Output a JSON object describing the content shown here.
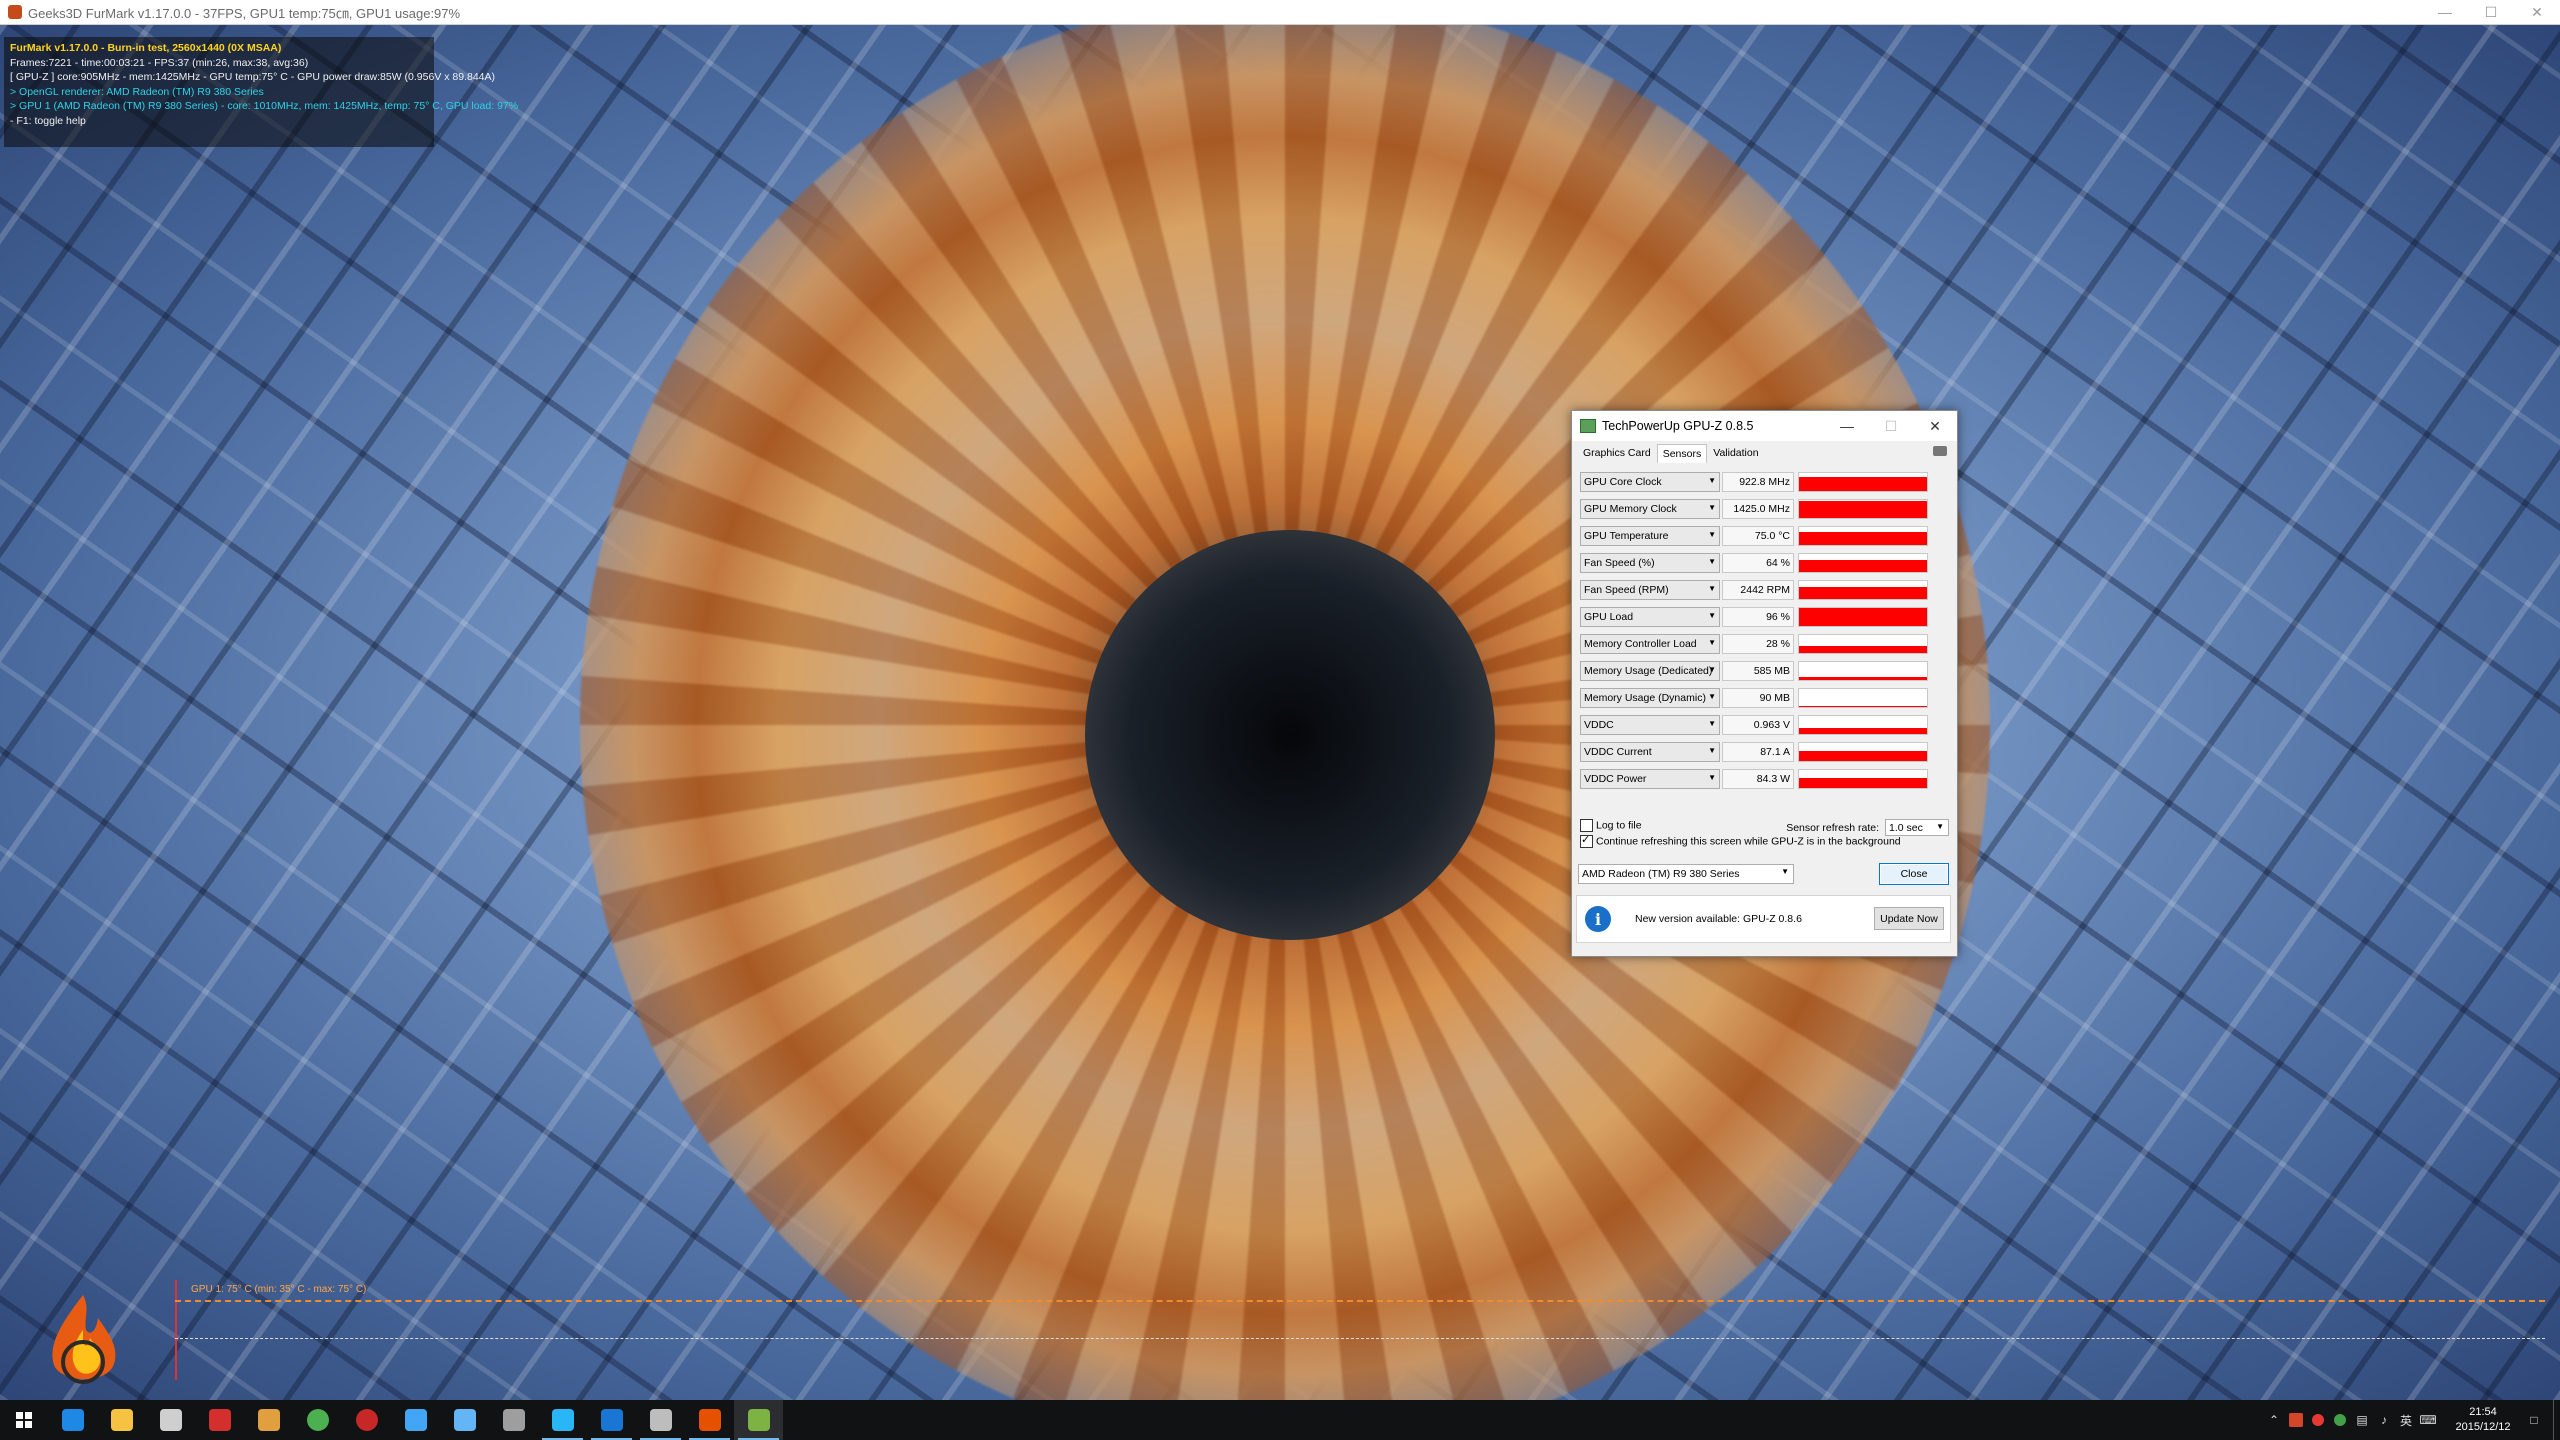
{
  "furmark": {
    "window_title": "Geeks3D FurMark v1.17.0.0 - 37FPS, GPU1 temp:75㎝, GPU1 usage:97%",
    "info_lines": {
      "line1": "FurMark v1.17.0.0 - Burn-in test, 2560x1440 (0X MSAA)",
      "line2": "Frames:7221 - time:00:03:21 - FPS:37 (min:26, max:38, avg:36)",
      "line3": "[ GPU-Z ] core:905MHz - mem:1425MHz - GPU temp:75° C - GPU power draw:85W (0.956V x 89.844A)",
      "line4": "> OpenGL renderer: AMD Radeon (TM) R9 380 Series",
      "line5": "> GPU 1 (AMD Radeon (TM) R9 380 Series) - core: 1010MHz, mem: 1425MHz, temp: 75° C, GPU load: 97%",
      "line6": "- F1: toggle help"
    },
    "graph_label": "GPU 1: 75° C (min: 35° C - max: 75° C)"
  },
  "gpuz": {
    "title": "TechPowerUp GPU-Z 0.8.5",
    "tabs": [
      "Graphics Card",
      "Sensors",
      "Validation"
    ],
    "active_tab": "Sensors",
    "sensors": [
      {
        "name": "GPU Core Clock",
        "value": "922.8 MHz",
        "level": 0.75
      },
      {
        "name": "GPU Memory Clock",
        "value": "1425.0 MHz",
        "level": 0.9
      },
      {
        "name": "GPU Temperature",
        "value": "75.0 °C",
        "level": 0.7
      },
      {
        "name": "Fan Speed (%)",
        "value": "64 %",
        "level": 0.65
      },
      {
        "name": "Fan Speed (RPM)",
        "value": "2442 RPM",
        "level": 0.65
      },
      {
        "name": "GPU Load",
        "value": "96 %",
        "level": 0.96
      },
      {
        "name": "Memory Controller Load",
        "value": "28 %",
        "level": 0.35
      },
      {
        "name": "Memory Usage (Dedicated)",
        "value": "585 MB",
        "level": 0.15
      },
      {
        "name": "Memory Usage (Dynamic)",
        "value": "90 MB",
        "level": 0.03
      },
      {
        "name": "VDDC",
        "value": "0.963 V",
        "level": 0.3
      },
      {
        "name": "VDDC Current",
        "value": "87.1 A",
        "level": 0.55
      },
      {
        "name": "VDDC Power",
        "value": "84.3 W",
        "level": 0.55
      }
    ],
    "log_to_file": "Log to file",
    "continue_refresh": "Continue refreshing this screen while GPU-Z is in the background",
    "refresh_label": "Sensor refresh rate:",
    "refresh_value": "1.0 sec",
    "gpu_select": "AMD Radeon (TM) R9 380 Series",
    "close_label": "Close",
    "update_msg": "New version available: GPU-Z 0.8.6",
    "update_button": "Update Now",
    "bar_color": "#ff0000"
  },
  "taskbar": {
    "apps": [
      "edge-icon",
      "file-explorer-icon",
      "store-icon",
      "app-red-icon",
      "app-folder-icon",
      "chrome-icon",
      "app-circle-icon",
      "app-blue-icon",
      "app-settings-icon",
      "app-shield-icon",
      "app-monitor-icon",
      "app-browser-icon",
      "app-face-icon",
      "furmark-icon",
      "gpuz-icon"
    ],
    "clock_time": "21:54",
    "clock_date": "2015/12/12",
    "ime": "英"
  }
}
